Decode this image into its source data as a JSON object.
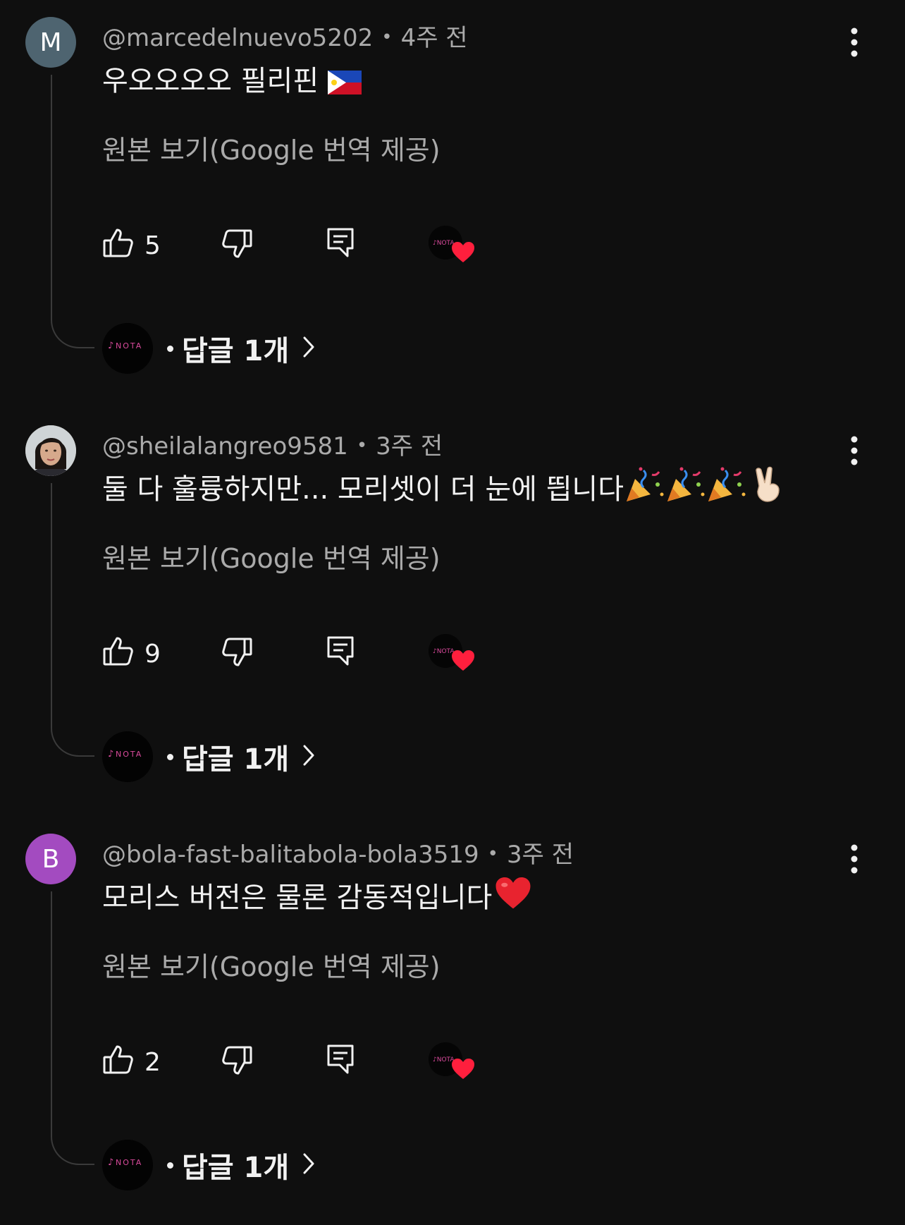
{
  "comments": [
    {
      "avatar_letter": "M",
      "avatar_color": "#4e6470",
      "author": "@marcedelnuevo5202",
      "time": "4주 전",
      "text": "우오오오오 필리핀",
      "text_emoji": "philippines-flag",
      "translate_label": "원본 보기(Google 번역 제공)",
      "likes": "5",
      "replies_label": "답글 1개",
      "creator_hearted": true
    },
    {
      "avatar_letter": "",
      "avatar_color": "#8a7a6a",
      "author": "@sheilalangreo9581",
      "time": "3주 전",
      "text": "둘 다 훌륭하지만... 모리셋이 더 눈에 띕니다",
      "text_emoji": "party-popper x3, victory-hand",
      "translate_label": "원본 보기(Google 번역 제공)",
      "likes": "9",
      "replies_label": "답글 1개",
      "creator_hearted": true
    },
    {
      "avatar_letter": "B",
      "avatar_color": "#a34bc0",
      "author": "@bola-fast-balitabola-bola3519",
      "time": "3주 전",
      "text": "모리스 버전은 물론 감동적입니다",
      "text_emoji": "red-heart",
      "translate_label": "원본 보기(Google 번역 제공)",
      "likes": "2",
      "replies_label": "답글 1개",
      "creator_hearted": true
    }
  ],
  "creator_logo_text": "NOTA",
  "colors": {
    "background": "#0f0f0f",
    "primary_text": "#f1f1f1",
    "secondary_text": "#aaaaaa",
    "heart": "#ff1f3d",
    "logo_pink": "#d94a9c"
  }
}
